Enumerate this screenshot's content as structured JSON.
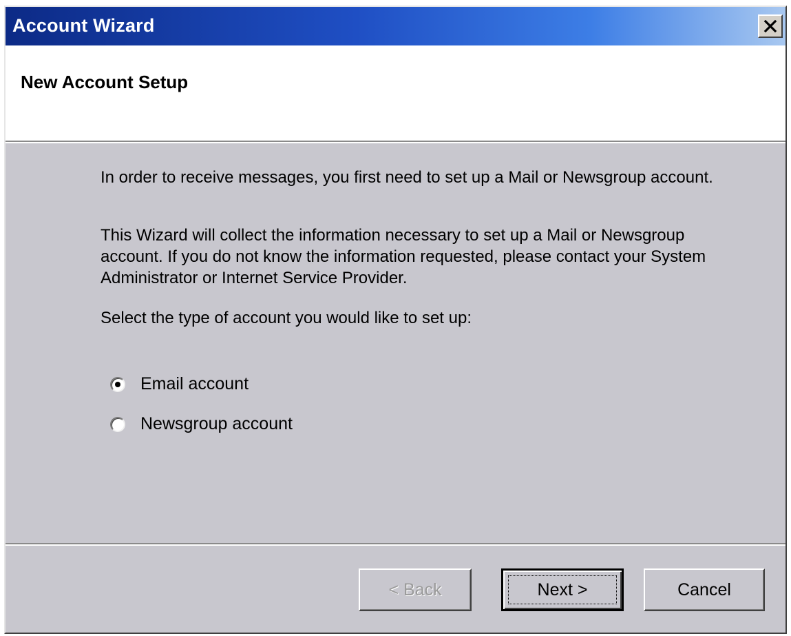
{
  "window": {
    "title": "Account Wizard",
    "close_symbol": "✕"
  },
  "header": {
    "title": "New Account Setup"
  },
  "body": {
    "intro": "In order to receive messages, you first need to set up a Mail or Newsgroup account.",
    "explanation": "This Wizard will collect the information necessary to set up a Mail or Newsgroup account. If you do not know the information requested, please contact your System Administrator or Internet Service Provider.",
    "prompt": "Select the type of account you would like to set up:"
  },
  "account_types": {
    "options": [
      {
        "label": "Email account",
        "selected": true
      },
      {
        "label": "Newsgroup account",
        "selected": false
      }
    ]
  },
  "buttons": {
    "back_label": "< Back",
    "back_enabled": false,
    "next_label": "Next >",
    "cancel_label": "Cancel"
  },
  "colors": {
    "titlebar_start": "#0c2a86",
    "titlebar_end": "#a8c8f0",
    "dialog_face": "#c8c7ce",
    "disabled_text": "#9a9a9a"
  },
  "icons": {
    "close": "close-icon",
    "radio_selected": "radio-selected-icon",
    "radio_unselected": "radio-unselected-icon"
  }
}
